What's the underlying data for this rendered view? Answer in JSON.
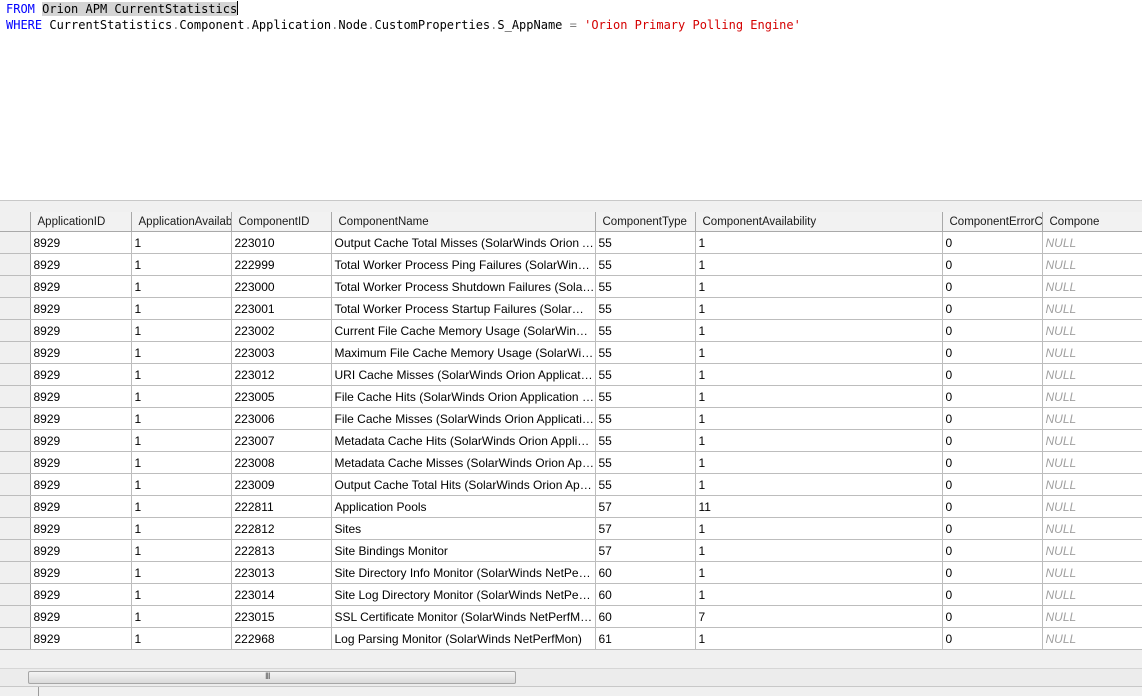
{
  "query": {
    "line1": {
      "keyword": "FROM",
      "object": "Orion APM CurrentStatistics"
    },
    "line2": {
      "keyword": "WHERE",
      "path": [
        "CurrentStatistics",
        "Component",
        "Application",
        "Node",
        "CustomProperties",
        "S_AppName"
      ],
      "operator": "=",
      "value": "'Orion Primary Polling Engine'"
    }
  },
  "grid": {
    "columns": [
      "ApplicationID",
      "ApplicationAvailabil",
      "ComponentID",
      "ComponentName",
      "ComponentType",
      "ComponentAvailability",
      "ComponentErrorCod",
      "Compone"
    ],
    "rows": [
      [
        "8929",
        "1",
        "223010",
        "Output Cache Total Misses (SolarWinds Orion Appli...",
        "55",
        "1",
        "0",
        "NULL"
      ],
      [
        "8929",
        "1",
        "222999",
        "Total Worker Process Ping Failures (SolarWinds Ori...",
        "55",
        "1",
        "0",
        "NULL"
      ],
      [
        "8929",
        "1",
        "223000",
        "Total Worker Process Shutdown Failures (SolarWin...",
        "55",
        "1",
        "0",
        "NULL"
      ],
      [
        "8929",
        "1",
        "223001",
        "Total Worker Process Startup Failures (SolarWinds ...",
        "55",
        "1",
        "0",
        "NULL"
      ],
      [
        "8929",
        "1",
        "223002",
        "Current File Cache Memory Usage (SolarWinds Orio...",
        "55",
        "1",
        "0",
        "NULL"
      ],
      [
        "8929",
        "1",
        "223003",
        "Maximum File Cache Memory Usage (SolarWinds Ori...",
        "55",
        "1",
        "0",
        "NULL"
      ],
      [
        "8929",
        "1",
        "223012",
        "URI Cache Misses (SolarWinds Orion Application Po...",
        "55",
        "1",
        "0",
        "NULL"
      ],
      [
        "8929",
        "1",
        "223005",
        "File Cache Hits (SolarWinds Orion Application Pool)",
        "55",
        "1",
        "0",
        "NULL"
      ],
      [
        "8929",
        "1",
        "223006",
        "File Cache Misses (SolarWinds Orion Application Pool)",
        "55",
        "1",
        "0",
        "NULL"
      ],
      [
        "8929",
        "1",
        "223007",
        "Metadata Cache Hits (SolarWinds Orion Application ...",
        "55",
        "1",
        "0",
        "NULL"
      ],
      [
        "8929",
        "1",
        "223008",
        "Metadata Cache Misses (SolarWinds Orion Applicati...",
        "55",
        "1",
        "0",
        "NULL"
      ],
      [
        "8929",
        "1",
        "223009",
        "Output Cache Total Hits (SolarWinds Orion Applicati...",
        "55",
        "1",
        "0",
        "NULL"
      ],
      [
        "8929",
        "1",
        "222811",
        "Application Pools",
        "57",
        "11",
        "0",
        "NULL"
      ],
      [
        "8929",
        "1",
        "222812",
        "Sites",
        "57",
        "1",
        "0",
        "NULL"
      ],
      [
        "8929",
        "1",
        "222813",
        "Site Bindings Monitor",
        "57",
        "1",
        "0",
        "NULL"
      ],
      [
        "8929",
        "1",
        "223013",
        "Site Directory Info Monitor (SolarWinds NetPerfMon)",
        "60",
        "1",
        "0",
        "NULL"
      ],
      [
        "8929",
        "1",
        "223014",
        "Site Log Directory Monitor (SolarWinds NetPerfMon)",
        "60",
        "1",
        "0",
        "NULL"
      ],
      [
        "8929",
        "1",
        "223015",
        "SSL Certificate Monitor (SolarWinds NetPerfMon)",
        "60",
        "7",
        "0",
        "NULL"
      ],
      [
        "8929",
        "1",
        "222968",
        "Log Parsing Monitor (SolarWinds NetPerfMon)",
        "61",
        "1",
        "0",
        "NULL"
      ]
    ]
  },
  "scrollbar": {
    "thumb_grip": "III",
    "position_fraction": 0.0
  }
}
